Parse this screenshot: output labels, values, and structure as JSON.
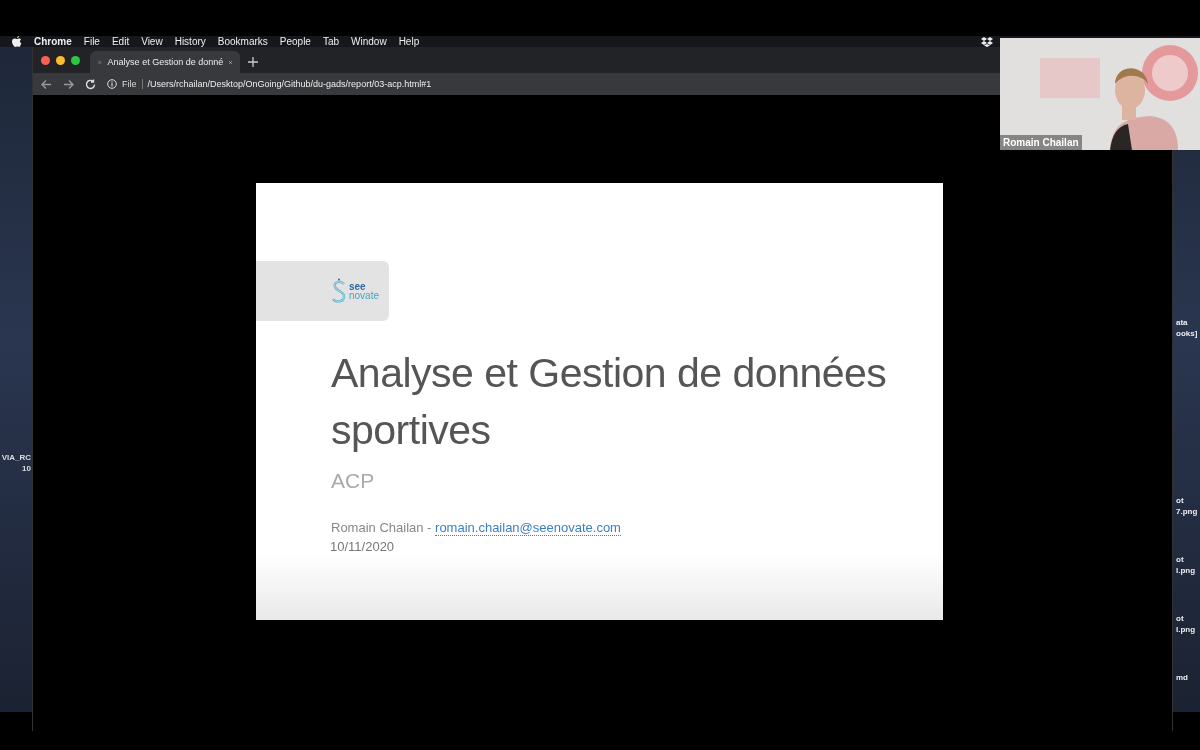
{
  "menu_bar": {
    "app": "Chrome",
    "items": [
      "File",
      "Edit",
      "View",
      "History",
      "Bookmarks",
      "People",
      "Tab",
      "Window",
      "Help"
    ]
  },
  "desktop": {
    "left_labels": [
      "VIA_RC",
      "10"
    ],
    "right_labels": [
      {
        "lines": [
          "ata",
          "ooks]"
        ]
      },
      {
        "lines": [
          "ot",
          "7.png"
        ]
      },
      {
        "lines": [
          "ot",
          "l.png"
        ]
      },
      {
        "lines": [
          "ot",
          "l.png"
        ]
      },
      {
        "lines": [
          "md"
        ]
      }
    ]
  },
  "browser": {
    "tabs": [
      {
        "title": "Analyse et Gestion de donné",
        "selected": true
      }
    ],
    "address": {
      "scheme": "File",
      "url": "/Users/rchailan/Desktop/OnGoing/Github/du-gads/report/03-acp.html#1"
    }
  },
  "slide": {
    "logo": [
      "see",
      "novate"
    ],
    "title": "Analyse et Gestion de données sportives",
    "subtitle": "ACP",
    "author": "Romain Chailan - ",
    "email": "romain.chailan@seenovate.com",
    "date": "10/11/2020"
  },
  "webcam": {
    "kind": "picture",
    "name": "Romain Chailan"
  }
}
